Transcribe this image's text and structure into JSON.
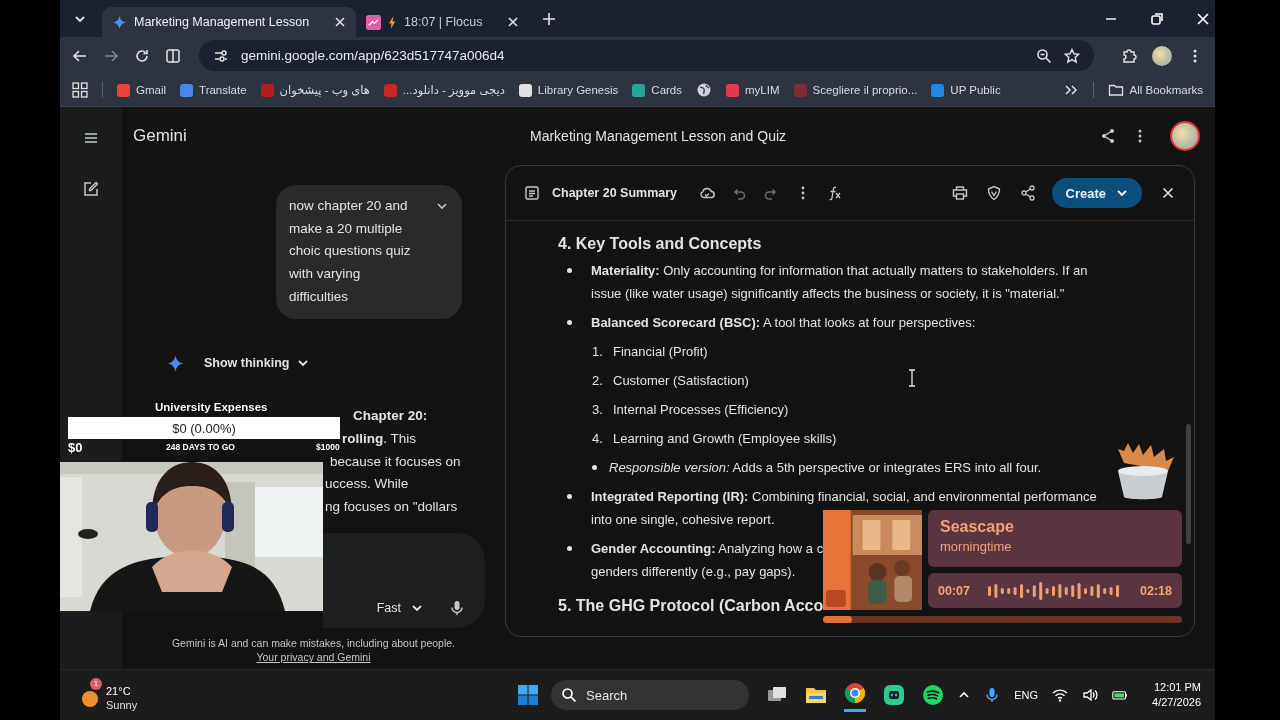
{
  "browser": {
    "tabs": [
      {
        "title": "Marketing Management Lesson",
        "selected": true,
        "kind": "gemini"
      },
      {
        "title": "18:07 | Flocus",
        "selected": false,
        "kind": "flocus"
      }
    ],
    "address": "gemini.google.com/app/623d517747a006d4",
    "bookmarks": [
      {
        "kind": "site",
        "label": "Gmail"
      },
      {
        "kind": "site",
        "label": "Translate"
      },
      {
        "kind": "site",
        "label": "های وب - پیشخوان"
      },
      {
        "kind": "site",
        "label": "دیجی موویز - دانلود..."
      },
      {
        "kind": "site",
        "label": "Library Genesis"
      },
      {
        "kind": "site",
        "label": "Cards"
      },
      {
        "kind": "globe"
      },
      {
        "kind": "site",
        "label": "myLIM"
      },
      {
        "kind": "site",
        "label": "Scegliere il proprio..."
      },
      {
        "kind": "site",
        "label": "UP Public"
      }
    ],
    "all_bookmarks": "All Bookmarks"
  },
  "gemini": {
    "brand": "Gemini",
    "title": "Marketing Management Lesson and Quiz",
    "prompt": "now chapter 20 and make a 20 multiple choic questions quiz with varying difficulties",
    "show_thinking": "Show thinking",
    "response_fragments": [
      "**Chapter 20:**",
      "**rolling**. This",
      "because it focuses on",
      "uccess. While",
      "ng focuses on \"dollars"
    ],
    "model": "Fast",
    "disclaimer": "Gemini is AI and can make mistakes, including about people.",
    "privacy_link": "Your privacy and Gemini"
  },
  "document": {
    "title": "Chapter 20 Summary",
    "create": "Create",
    "sections": [
      {
        "heading": "4. Key Tools and Concepts",
        "items": [
          {
            "text": "**Materiality:** Only accounting for information that actually matters to stakeholders. If an issue (like water usage) significantly affects the business or society, it is \"material.\""
          },
          {
            "text": "**Balanced Scorecard (BSC):** A tool that looks at four perspectives:",
            "numbered": [
              {
                "num": "1.",
                "text": "Financial (Profit)"
              },
              {
                "num": "2.",
                "text": "Customer (Satisfaction)"
              },
              {
                "num": "3.",
                "text": "Internal Processes (Efficiency)"
              },
              {
                "num": "4.",
                "text": "Learning and Growth (Employee skills)"
              }
            ],
            "sub_bullets": [
              "*Responsible version:* Adds a 5th perspective or integrates ERS into all four."
            ]
          },
          {
            "text": "**Integrated Reporting (IR):** Combining financial, social, and environmental performance",
            "continuation": "into one single, cohesive report."
          },
          {
            "text": "**Gender Accounting:** Analyzing how a c",
            "continuation": "genders differently (e.g., pay gaps)."
          }
        ]
      },
      {
        "heading": "5. The GHG Protocol (Carbon Acco"
      }
    ]
  },
  "expense_tracker": {
    "title": "University Expenses",
    "reading": "$0 (0.00%)",
    "level": 0,
    "current": "$0",
    "days_left": "248 DAYS TO GO",
    "goal": "$1000"
  },
  "music": {
    "track": "Seascape",
    "artist": "morningtime",
    "elapsed": "00:07",
    "total": "02:18",
    "level": 0.08
  },
  "taskbar": {
    "weather": {
      "temp": "21°C",
      "condition": "Sunny",
      "badge": "1"
    },
    "search": "Search",
    "language": "ENG",
    "time": "12:01 PM",
    "date": "4/27/2026"
  }
}
